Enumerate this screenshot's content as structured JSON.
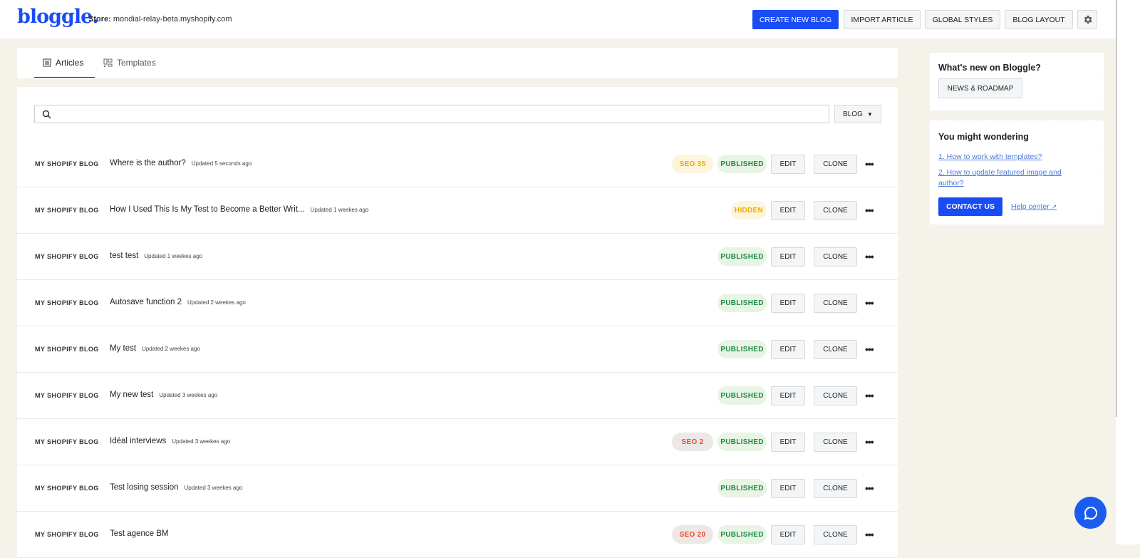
{
  "header": {
    "logo": "bloggle.",
    "store_label": "Store:",
    "store": "mondial-relay-beta.myshopify.com",
    "buttons": {
      "create": "CREATE NEW BLOG",
      "import": "IMPORT ARTICLE",
      "styles": "GLOBAL STYLES",
      "layout": "BLOG LAYOUT"
    }
  },
  "tabs": [
    {
      "label": "Articles"
    },
    {
      "label": "Templates"
    }
  ],
  "search": {
    "placeholder": "",
    "value": ""
  },
  "blog_filter": "BLOG",
  "row_actions": {
    "edit": "EDIT",
    "clone": "CLONE"
  },
  "articles": [
    {
      "blog": "MY SHOPIFY BLOG",
      "title": "Where is the author?",
      "updated": "Updated 5 seconds ago",
      "seo": "SEO 35",
      "seo_color": "yellow",
      "status": "PUBLISHED"
    },
    {
      "blog": "MY SHOPIFY BLOG",
      "title": "How I Used This Is My Test to Become a Better Writ...",
      "updated": "Updated 1 weekes ago",
      "seo": null,
      "status": "HIDDEN"
    },
    {
      "blog": "MY SHOPIFY BLOG",
      "title": "test test",
      "updated": "Updated 1 weekes ago",
      "seo": null,
      "status": "PUBLISHED"
    },
    {
      "blog": "MY SHOPIFY BLOG",
      "title": "Autosave function 2",
      "updated": "Updated 2 weekes ago",
      "seo": null,
      "status": "PUBLISHED"
    },
    {
      "blog": "MY SHOPIFY BLOG",
      "title": "My test",
      "updated": "Updated 2 weekes ago",
      "seo": null,
      "status": "PUBLISHED"
    },
    {
      "blog": "MY SHOPIFY BLOG",
      "title": "My new test",
      "updated": "Updated 3 weekes ago",
      "seo": null,
      "status": "PUBLISHED"
    },
    {
      "blog": "MY SHOPIFY BLOG",
      "title": "Idéal interviews",
      "updated": "Updated 3 weekes ago",
      "seo": "SEO 2",
      "seo_color": "red",
      "status": "PUBLISHED"
    },
    {
      "blog": "MY SHOPIFY BLOG",
      "title": "Test losing session",
      "updated": "Updated 3 weekes ago",
      "seo": null,
      "status": "PUBLISHED"
    },
    {
      "blog": "MY SHOPIFY BLOG",
      "title": "Test agence BM",
      "updated": "",
      "seo": "SEO 20",
      "seo_color": "red",
      "status": "PUBLISHED"
    }
  ],
  "sidebar": {
    "news": {
      "title": "What's new on Bloggle?",
      "button": "NEWS & ROADMAP"
    },
    "help": {
      "title": "You might wondering",
      "links": [
        "1. How to work with templates?",
        "2. How to update featured image and author?"
      ],
      "contact": "CONTACT US",
      "help_center": "Help center"
    }
  },
  "colors": {
    "accent": "#1a4cf5",
    "published": "#1f8c4a",
    "warning": "#f4a800",
    "danger": "#f04a2a"
  }
}
